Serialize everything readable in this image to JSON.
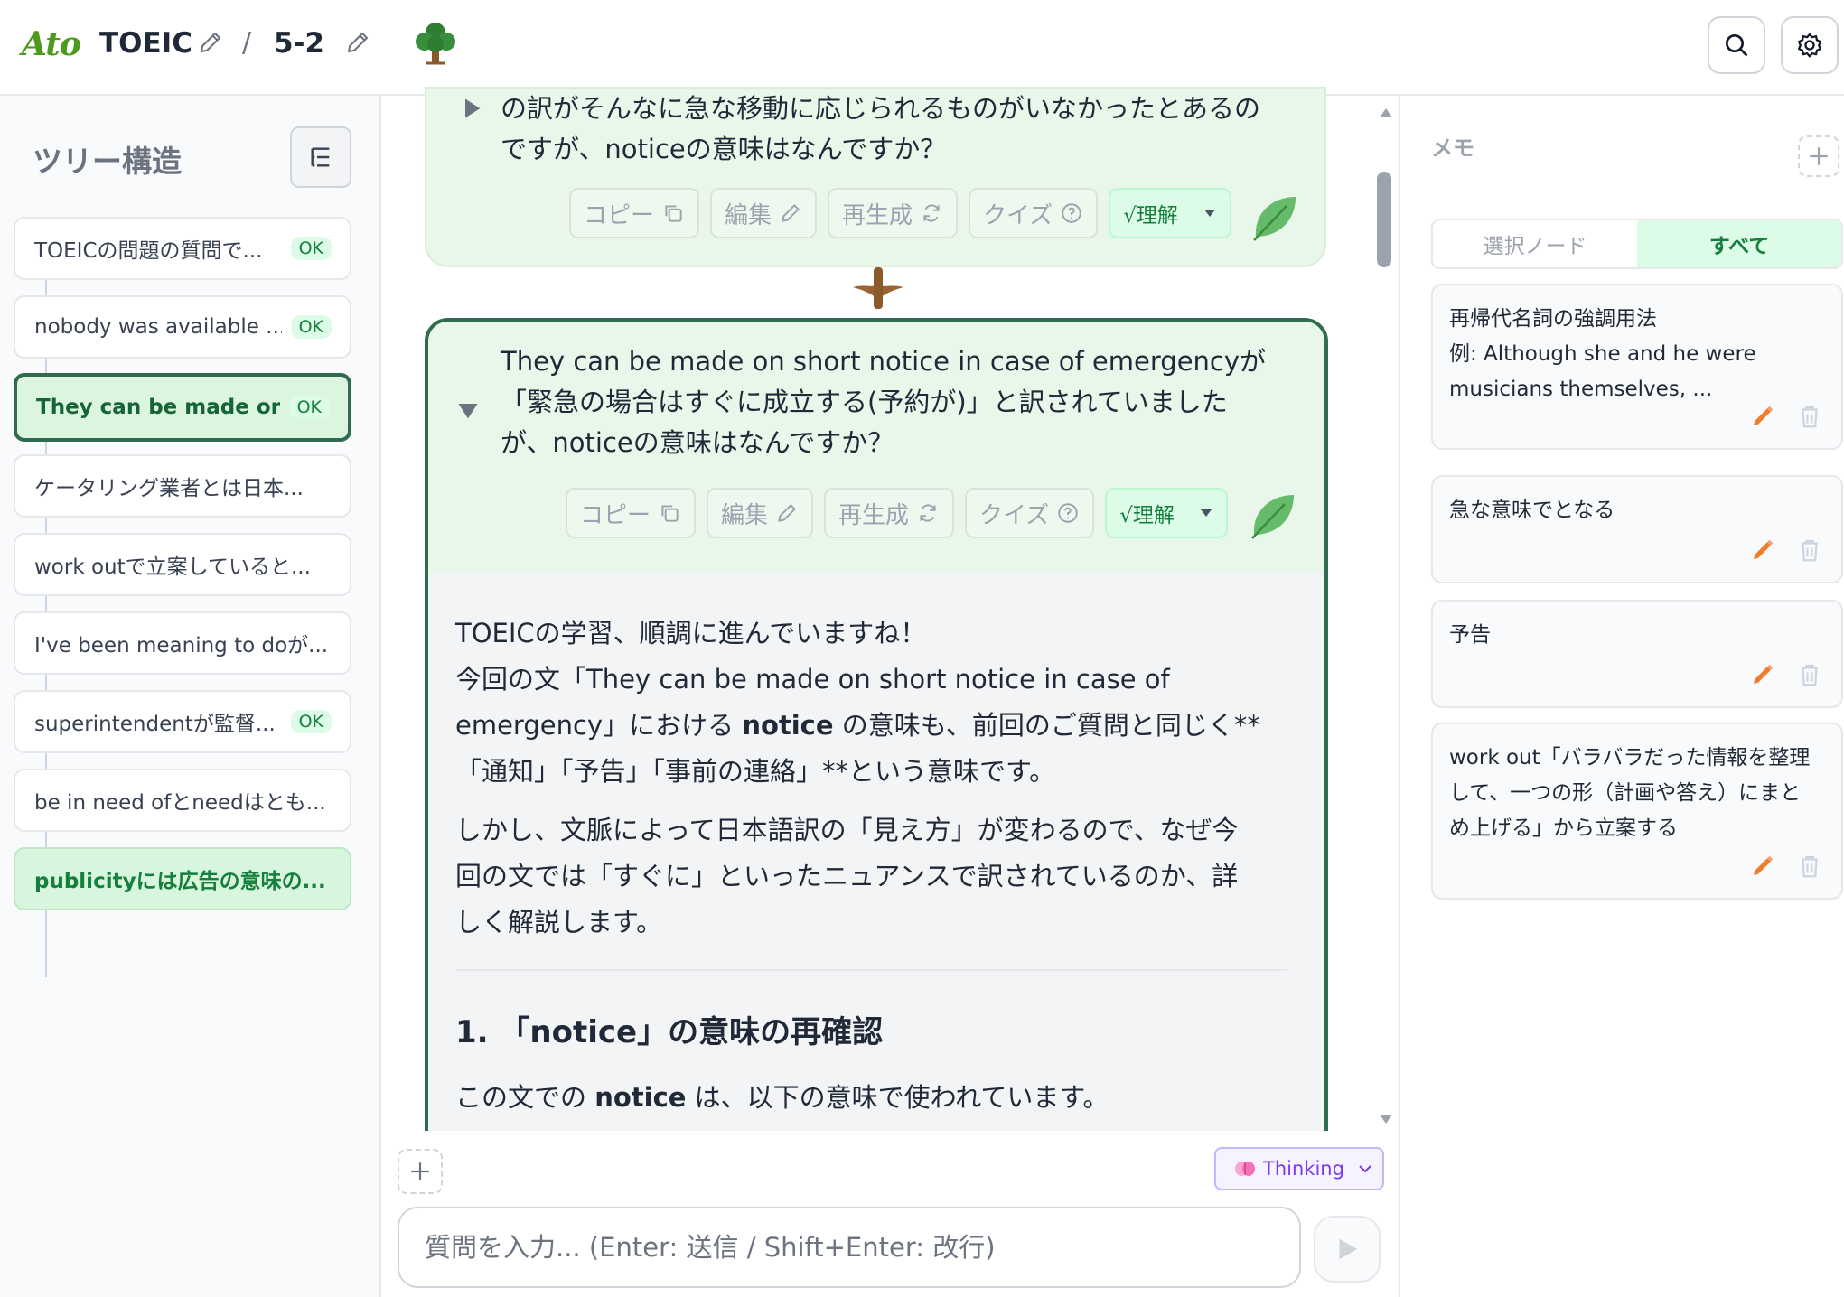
{
  "header": {
    "logo": "Ato",
    "project": "TOEIC",
    "separator": "/",
    "page": "5-2"
  },
  "sidebar": {
    "title": "ツリー構造",
    "nodes": [
      {
        "label": "TOEICの問題の質問で...",
        "badge": "OK"
      },
      {
        "label": "nobody was available ...",
        "badge": "OK"
      },
      {
        "label": "They can be made on...",
        "badge": "OK"
      },
      {
        "label": "ケータリング業者とは日本...",
        "badge": ""
      },
      {
        "label": "work outで立案していると...",
        "badge": ""
      },
      {
        "label": "I've been meaning to doが...",
        "badge": ""
      },
      {
        "label": "superintendentが監督...",
        "badge": "OK"
      },
      {
        "label": "be in need ofとneedはとも...",
        "badge": ""
      },
      {
        "label": "publicityには広告の意味の...",
        "badge": ""
      }
    ]
  },
  "chat": {
    "prev_question_line1": "の訳がそんなに急な移動に応じられるものがいなかったとあるの",
    "prev_question_line2": "ですが、noticeの意味はなんですか？",
    "actions": {
      "copy": "コピー",
      "edit": "編集",
      "regenerate": "再生成",
      "quiz": "クイズ",
      "understood": "√理解"
    },
    "question_line1": "They can be made on short notice in case of emergencyが",
    "question_line2": "「緊急の場合はすぐに成立する(予約が)」と訳されていました",
    "question_line3": "が、noticeの意味はなんですか？",
    "answer": {
      "p1_line1": "TOEICの学習、順調に進んでいますね！",
      "p1_line2": "今回の文「They can be made on short notice in case of",
      "p1_line3a": "emergency」における ",
      "p1_line3b": "notice",
      "p1_line3c": " の意味も、前回のご質問と同じく**",
      "p1_line4": "「通知」「予告」「事前の連絡」**という意味です。",
      "p2_line1": "しかし、文脈によって日本語訳の「見え方」が変わるので、なぜ今",
      "p2_line2": "回の文では「すぐに」といったニュアンスで訳されているのか、詳",
      "p2_line3": "しく解説します。",
      "h1": "1. 「notice」の意味の再確認",
      "p3a": "この文での ",
      "p3b": "notice",
      "p3c": " は、以下の意味で使われています。"
    },
    "mode": "Thinking",
    "input_placeholder": "質問を入力... (Enter: 送信 / Shift+Enter: 改行)"
  },
  "memo": {
    "title": "メモ",
    "tabs": [
      "選択ノード",
      "すべて"
    ],
    "active_tab": "すべて",
    "items": [
      {
        "text": "再帰代名詞の強調用法\n例: Although she and he were\nmusicians themselves, ..."
      },
      {
        "text": "急な意味でとなる"
      },
      {
        "text": "予告"
      },
      {
        "text": "work out「バラバラだった情報を整理\nして、一つの形（計画や答え）にまと\nめ上げる」から立案する"
      }
    ]
  },
  "colors": {
    "accent_green": "#15803d",
    "selected_border": "#2f6b50",
    "card_bg": "#e8f7ea",
    "pencil": "#ef7d2c"
  }
}
